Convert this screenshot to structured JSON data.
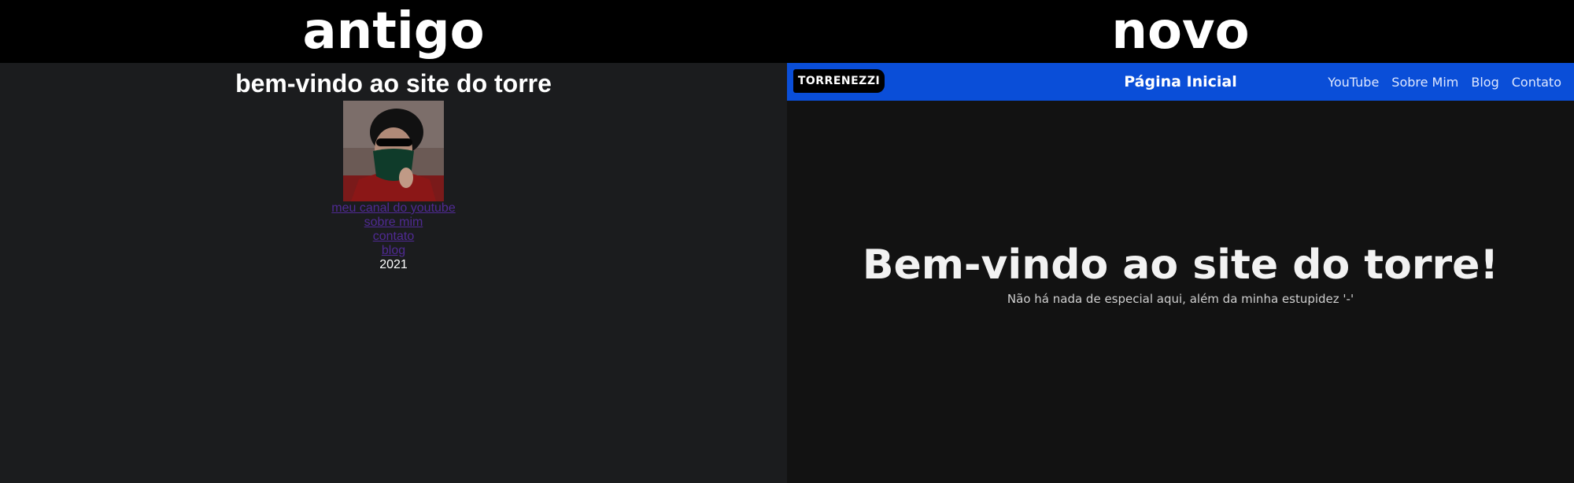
{
  "captions": {
    "old": "antigo",
    "new": "novo"
  },
  "old_site": {
    "title": "bem-vindo ao site do torre",
    "links": [
      "meu canal do youtube",
      "sobre mim",
      "contato",
      "blog"
    ],
    "year": "2021"
  },
  "new_site": {
    "brand": "TORRENEZZI",
    "nav_title": "Página Inicial",
    "nav_links": [
      "YouTube",
      "Sobre Mim",
      "Blog",
      "Contato"
    ],
    "hero_title": "Bem-vindo ao site do torre!",
    "hero_subtitle": "Não há nada de especial aqui, além da minha estupidez '-'"
  },
  "colors": {
    "old_background": "#1b1c1e",
    "old_link": "#4f2a93",
    "new_background": "#121212",
    "navbar": "#0a4ed8",
    "brand_bg": "#000000"
  }
}
